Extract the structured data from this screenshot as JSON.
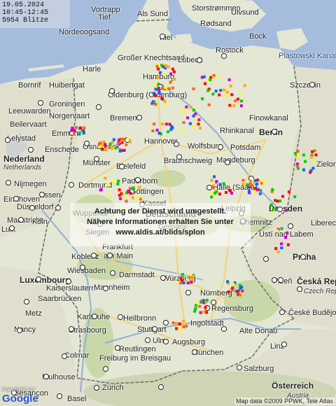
{
  "info": {
    "date": "19.05.2024",
    "time_range": "10:45-12:45",
    "count": "5954 Blitze"
  },
  "notice": {
    "line1": "Achtung der Dienst wird umgestellt.",
    "line2": "Nähere Informationen erhalten Sie unter",
    "line3": "www.aldis.at/blids/splon"
  },
  "copyright": "Map data ©2009 PPWK, Tele Atlas",
  "logo": {
    "powered_by": "POWERED BY",
    "brand": "Google"
  },
  "colors": {
    "water": "#a6bcdd",
    "land_de": "#e9ecd8",
    "land_neighbor": "#dcd9cc",
    "forest": "#c8d9a7",
    "border": "#6d6d6d",
    "strike_scale": [
      "#ff0000",
      "#ff6600",
      "#ffaa00",
      "#ffff00",
      "#00cc00",
      "#0066ff",
      "#cc00cc"
    ]
  },
  "labels": {
    "vortrapp": "Vortrapp",
    "tief": "Tief",
    "als_sund": "Als Sund",
    "storstrommen": "Storstrømmen",
    "ulvsund": "Ulvsund",
    "nordeoogsand": "Nordeoogsand",
    "rodsand": "Rødsand",
    "kiel": "Kiel",
    "bock": "Bock",
    "grosser_knechtsand": "Großer Knechtsand",
    "harle": "Harle",
    "lubeck": "Lübeck",
    "rostock": "Rostock",
    "plastowski_kanal": "Plastowski Kanal",
    "bornrif": "Bornrif",
    "huibertgat": "Huibertgat",
    "hamburg": "Hamburg",
    "szczecin": "Szczecin",
    "groningen": "Groningen",
    "oldenburg": "Oldenburg (Oldenburg)",
    "leeuwarden": "Leeuwarden",
    "norgervaart": "Norgervaart",
    "bremen": "Bremen",
    "finowkanal": "Finowkanal",
    "beilervaart": "Beilervaart",
    "emmen": "Emmen",
    "rhinkanal": "Rhinkanal",
    "berlin": "Berlin",
    "lelystad": "Lelystad",
    "osnabruck": "Osnabrück",
    "hannover": "Hannover",
    "wolfsburg": "Wolfsburg",
    "potsdam": "Potsdam",
    "enschede": "Enschede",
    "nederland": "Nederland",
    "netherlands": "Netherlands",
    "munster": "Münster",
    "bielefeld": "Bielefeld",
    "braunschweig": "Braunschweig",
    "magdeburg": "Magdeburg",
    "zielona": "Zielona",
    "nijmegen": "Nijmegen",
    "paderborn": "Paderborn",
    "dortmund": "Dortmund",
    "gottingen": "Göttingen",
    "halle": "Halle (Saale)",
    "essen": "Essen",
    "eindhoven": "Eindhoven",
    "dusseldorf": "Düsseldorf",
    "kassel": "Kassel",
    "leipzig": "Leipzig",
    "dresden": "Dresden",
    "wuppertal": "Wuppertal",
    "deutschland": "Deutschland",
    "maastricht": "Maastricht",
    "koln": "Köln",
    "siegen": "Siegen",
    "germany": "Germany",
    "chemnitz": "Chemnitz",
    "liberec": "Liberec",
    "luik": "Luik",
    "usti_nad_labem": "Ústí nad Labem",
    "frankfurt": "Frankfurt",
    "koblenz": "Koblenz",
    "am_main": "am Main",
    "praha": "Praha",
    "wiesbaden": "Wiesbaden",
    "darmstadt": "Darmstadt",
    "luxembourg": "Luxembourg",
    "kaiserslautern": "Kaiserslautern",
    "mannheim": "Mannheim",
    "wurzburg": "Würzburg",
    "plzen": "Plzeň",
    "ceska_rep": "Česká Rep",
    "czech_rep": "Czech Rep",
    "saarbrucken": "Saarbrücken",
    "nurnberg": "Nürnberg",
    "metz": "Metz",
    "karlsruhe": "Karlsruhe",
    "regensburg": "Regensburg",
    "ceske_budejovice": "České Budějovice",
    "nancy": "Nancy",
    "heilbronn": "Heilbronn",
    "strasbourg": "Strasbourg",
    "ingolstadt": "Ingolstadt",
    "alte_donau": "Alte Donau",
    "stuttgart": "Stuttgart",
    "ulm": "Ulm",
    "augsburg": "Augsburg",
    "colmar": "Colmar",
    "reutlingen": "Reutlingen",
    "munchen": "München",
    "freiburg": "Freiburg im Breisgau",
    "linz": "Linz",
    "mulhouse": "Mulhouse",
    "salzburg": "Salzburg",
    "besancon": "Besançon",
    "basel": "Basel",
    "zurich": "Zürich",
    "osterreich": "Österreich",
    "austria": "Austria",
    "luxembourg2": "Luxembourg",
    "tele": "Tele"
  }
}
